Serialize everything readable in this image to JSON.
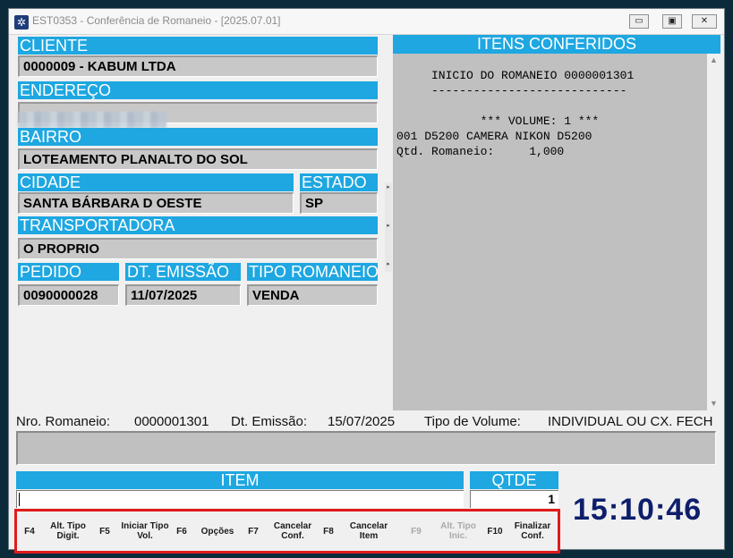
{
  "window": {
    "title": "EST0353 - Conferência de Romaneio - [2025.07.01]",
    "icon": "app-logo-icon",
    "controls": [
      "minimize",
      "maximize",
      "close"
    ]
  },
  "cliente": {
    "label": "CLIENTE",
    "value": "0000009 - KABUM LTDA"
  },
  "endereco": {
    "label": "ENDEREÇO",
    "value": ""
  },
  "bairro": {
    "label": "BAIRRO",
    "value": "LOTEAMENTO PLANALTO DO SOL"
  },
  "cidade": {
    "label": "CIDADE",
    "value": "SANTA BÁRBARA D OESTE"
  },
  "estado": {
    "label": "ESTADO",
    "value": "SP"
  },
  "transportadora": {
    "label": "TRANSPORTADORA",
    "value": "O PROPRIO"
  },
  "pedido": {
    "label": "PEDIDO",
    "value": "0090000028"
  },
  "dt_emissao": {
    "label": "DT. EMISSÃO",
    "value": "11/07/2025"
  },
  "tipo_romaneio": {
    "label": "TIPO ROMANEIO",
    "value": "VENDA"
  },
  "itens": {
    "header": "ITENS CONFERIDOS",
    "text": "     INICIO DO ROMANEIO 0000001301\n     ----------------------------\n\n            *** VOLUME: 1 ***\n001 D5200 CAMERA NIKON D5200\nQtd. Romaneio:     1,000"
  },
  "info": {
    "nro_label": "Nro. Romaneio:",
    "nro_value": "0000001301",
    "dt_label": "Dt. Emissão:",
    "dt_value": "15/07/2025",
    "tipo_label": "Tipo de Volume:",
    "tipo_value": "INDIVIDUAL OU CX. FECH"
  },
  "item": {
    "label": "ITEM",
    "value": ""
  },
  "qtde": {
    "label": "QTDE",
    "value": "1"
  },
  "clock": "15:10:46",
  "function_keys": [
    {
      "key": "F4",
      "label": "Alt. Tipo Digit.",
      "enabled": true
    },
    {
      "key": "F5",
      "label": "Iniciar Tipo Vol.",
      "enabled": true
    },
    {
      "key": "F6",
      "label": "Opções",
      "enabled": true
    },
    {
      "key": "F7",
      "label": "Cancelar Conf.",
      "enabled": true
    },
    {
      "key": "F8",
      "label": "Cancelar Item",
      "enabled": true
    },
    {
      "key": "F9",
      "label": "Alt. Tipo Inic.",
      "enabled": false
    },
    {
      "key": "F10",
      "label": "Finalizar Conf.",
      "enabled": true
    }
  ]
}
